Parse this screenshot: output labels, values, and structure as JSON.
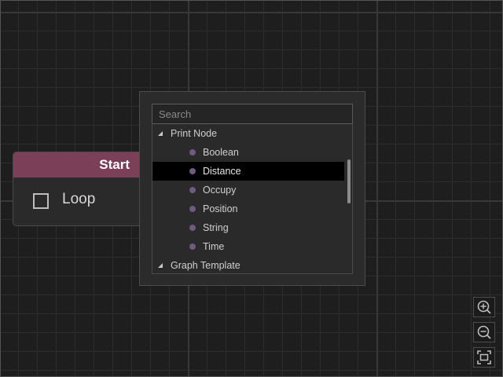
{
  "node": {
    "title": "Start",
    "header_color": "#7b3f57",
    "checkbox": {
      "label": "Loop",
      "checked": false
    }
  },
  "search_popup": {
    "search": {
      "placeholder": "Search",
      "value": ""
    },
    "tree": [
      {
        "type": "group",
        "label": "Print Node",
        "expanded": true
      },
      {
        "type": "leaf",
        "label": "Boolean"
      },
      {
        "type": "leaf",
        "label": "Distance",
        "selected": true
      },
      {
        "type": "leaf",
        "label": "Occupy"
      },
      {
        "type": "leaf",
        "label": "Position"
      },
      {
        "type": "leaf",
        "label": "String"
      },
      {
        "type": "leaf",
        "label": "Time"
      },
      {
        "type": "group",
        "label": "Graph Template",
        "expanded": true
      }
    ],
    "leaf_dot_color": "#6e5a82"
  },
  "zoom_controls": [
    {
      "icon": "zoom-in-icon"
    },
    {
      "icon": "zoom-out-icon"
    },
    {
      "icon": "fit-view-icon"
    }
  ]
}
